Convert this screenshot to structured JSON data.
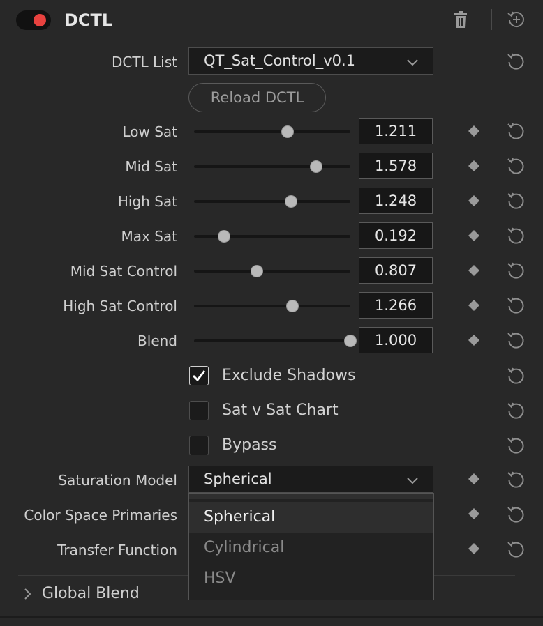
{
  "header": {
    "title": "DCTL",
    "toggle_on": true,
    "accent": "#e8423f"
  },
  "dctl_list": {
    "label": "DCTL List",
    "value": "QT_Sat_Control_v0.1"
  },
  "reload_button": {
    "label": "Reload DCTL"
  },
  "sliders": [
    {
      "label": "Low Sat",
      "value": "1.211",
      "fraction": 0.6
    },
    {
      "label": "Mid Sat",
      "value": "1.578",
      "fraction": 0.78
    },
    {
      "label": "High Sat",
      "value": "1.248",
      "fraction": 0.62
    },
    {
      "label": "Max Sat",
      "value": "0.192",
      "fraction": 0.19
    },
    {
      "label": "Mid Sat Control",
      "value": "0.807",
      "fraction": 0.4
    },
    {
      "label": "High Sat Control",
      "value": "1.266",
      "fraction": 0.63
    },
    {
      "label": "Blend",
      "value": "1.000",
      "fraction": 1.0
    }
  ],
  "checkboxes": [
    {
      "label": "Exclude Shadows",
      "checked": true
    },
    {
      "label": "Sat v Sat Chart",
      "checked": false
    },
    {
      "label": "Bypass",
      "checked": false
    }
  ],
  "saturation_model": {
    "label": "Saturation Model",
    "value": "Spherical",
    "options": [
      "Spherical",
      "Cylindrical",
      "HSV"
    ]
  },
  "color_space_primaries": {
    "label": "Color Space Primaries"
  },
  "transfer_function": {
    "label": "Transfer Function"
  },
  "global_blend": {
    "label": "Global Blend"
  }
}
